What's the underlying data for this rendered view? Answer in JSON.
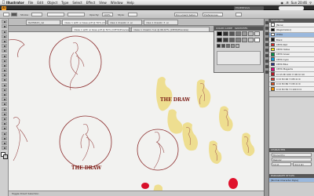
{
  "menubar": {
    "app_name": "Illustrator",
    "items": [
      "File",
      "Edit",
      "Object",
      "Type",
      "Select",
      "Effect",
      "View",
      "Window",
      "Help"
    ],
    "clock": "Sun 20:46"
  },
  "appbar": {
    "logo": "Ai",
    "workspace": "ESSENTIALS"
  },
  "controlbar": {
    "stroke_label": "Stroke:",
    "style_label": "Style:",
    "opacity_label": "Opacity:",
    "opacity_value": "100%",
    "document_setup": "Document Setup",
    "preferences": "Preferences"
  },
  "tabs": [
    {
      "label": "8a3f9443_nsl"
    },
    {
      "label": "ideas 1 with ai base.pdf @ 50% (CMYK/Preview)"
    },
    {
      "label": "idea 1 drawlin 2 .ai"
    },
    {
      "label": "idea 1 drawlin 3 .ai"
    }
  ],
  "tabs2": [
    {
      "label": "ideas 1 with ai base.pdf @ 50% (CMYK/Preview)"
    },
    {
      "label": "ideas 1 drawlin 3.ai @ 66.67% (CMYK/Preview)"
    }
  ],
  "canvas": {
    "logo_text": "THE DRAW"
  },
  "statusbar": {
    "text": "Toggle Direct Selection"
  },
  "color_panel": {
    "tabs": [
      "COLOR GUIDE",
      "SWATCHES"
    ],
    "swatch_colors": [
      "#000000",
      "#333333",
      "#555555",
      "#777777",
      "#999999",
      "#bbbbbb",
      "#dddddd",
      "#ffffff"
    ]
  },
  "right_panel": {
    "swatches_header": "SWATCHES",
    "swatches": [
      {
        "name": "[None]",
        "color": "#ffffff"
      },
      {
        "name": "[Registration]",
        "color": "#000000"
      },
      {
        "name": "White",
        "color": "#ffffff"
      },
      {
        "name": "Black",
        "color": "#111111"
      },
      {
        "name": "CMYK Red",
        "color": "#e52421"
      },
      {
        "name": "CMYK Yellow",
        "color": "#ffec00"
      },
      {
        "name": "CMYK Green",
        "color": "#00964b"
      },
      {
        "name": "CMYK Cyan",
        "color": "#009fe3"
      },
      {
        "name": "CMYK Blue",
        "color": "#2c2e83"
      },
      {
        "name": "CMYK Magenta",
        "color": "#e5007e"
      },
      {
        "name": "C=15 M=100 Y=90 K=10",
        "color": "#be1622"
      },
      {
        "name": "C=0 M=90 Y=85 K=0",
        "color": "#e6332a"
      },
      {
        "name": "C=0 M=80 Y=95 K=0",
        "color": "#e94e1b"
      },
      {
        "name": "C=0 M=50 Y=100 K=0",
        "color": "#f39200"
      }
    ],
    "character_header": "CHARACTER",
    "font_name": "Myriad Pro",
    "font_style": "Regular",
    "font_size": "12 pt",
    "leading": "(14.4 pt)",
    "paragraph_header": "PARAGRAPH STYLES",
    "paragraph_item": "[Normal Character Style]"
  }
}
